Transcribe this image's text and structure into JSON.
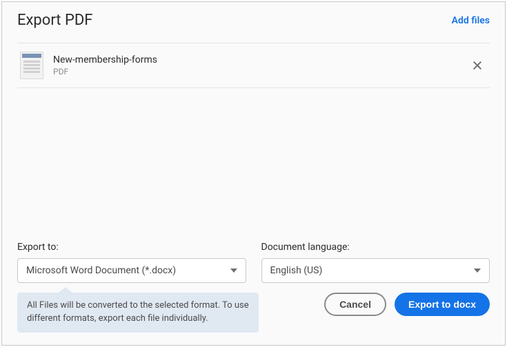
{
  "header": {
    "title": "Export PDF",
    "add_files_label": "Add files"
  },
  "files": [
    {
      "name": "New-membership-forms",
      "type": "PDF"
    }
  ],
  "export_to": {
    "label": "Export to:",
    "value": "Microsoft Word Document (*.docx)"
  },
  "language": {
    "label": "Document language:",
    "value": "English (US)"
  },
  "tooltip": "All Files will be converted to the selected format. To use different formats, export each file individually.",
  "actions": {
    "cancel": "Cancel",
    "export": "Export to docx"
  }
}
